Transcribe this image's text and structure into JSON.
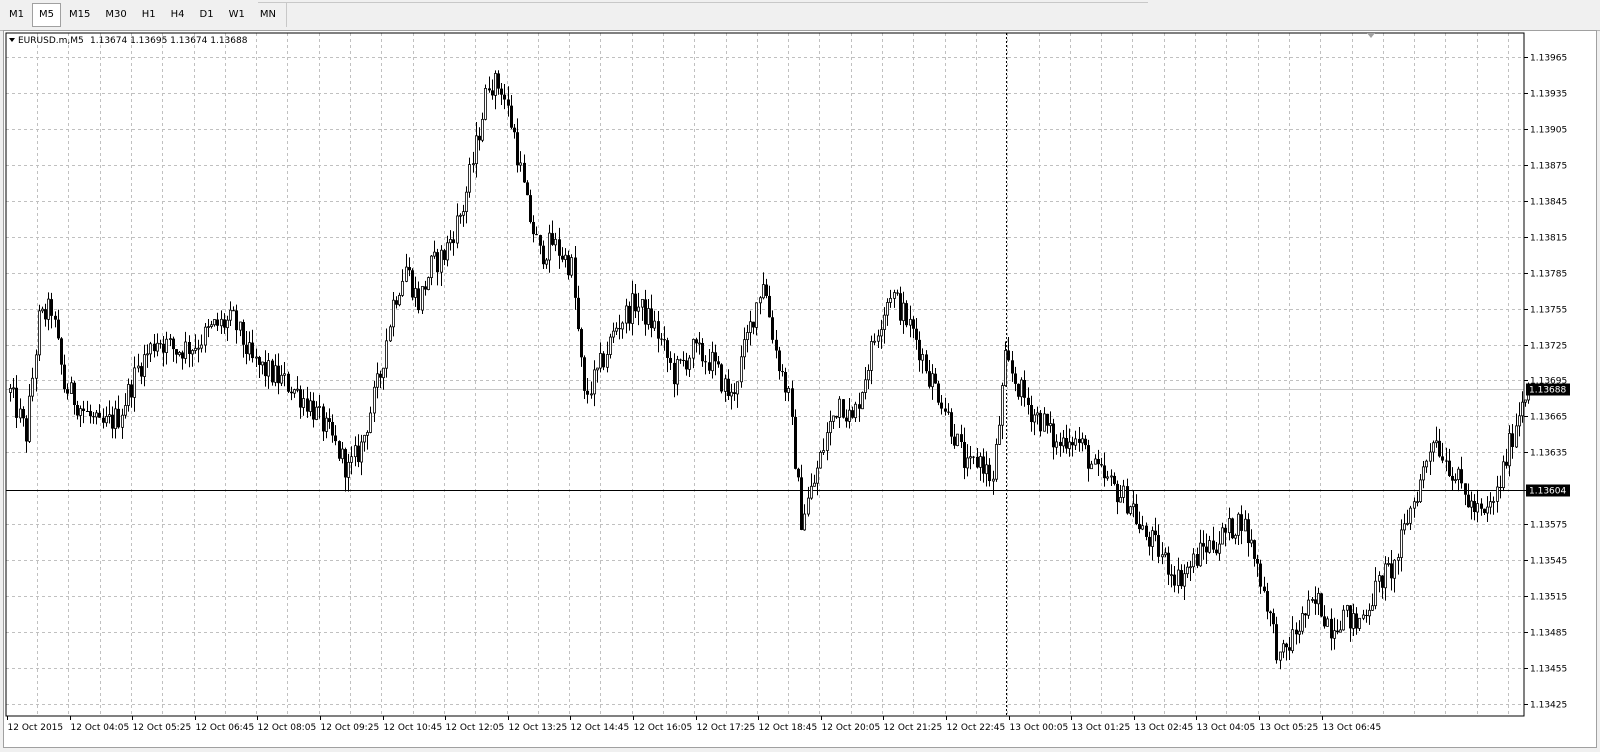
{
  "toolbar": {
    "timeframes": [
      "M1",
      "M5",
      "M15",
      "M30",
      "H1",
      "H4",
      "D1",
      "W1",
      "MN"
    ],
    "active": "M5"
  },
  "chart_header": {
    "symbol": "EURUSD.m,M5",
    "ohlc": "1.13674 1.13695 1.13674 1.13688"
  },
  "colors": {
    "background": "#ffffff",
    "grid": "#c0c0c0",
    "candle": "#000000",
    "bid_line": "#000000",
    "price_label_bg": "#000000",
    "price_label_text": "#ffffff"
  },
  "chart_data": {
    "type": "candlestick",
    "timeframe": "M5",
    "y_tick_labels": [
      "1.13965",
      "1.13935",
      "1.13905",
      "1.13875",
      "1.13845",
      "1.13815",
      "1.13785",
      "1.13755",
      "1.13725",
      "1.13695",
      "1.13665",
      "1.13635",
      "1.13604",
      "1.13575",
      "1.13545",
      "1.13515",
      "1.13485",
      "1.13455",
      "1.13425"
    ],
    "x_tick_labels": [
      "12 Oct 2015",
      "12 Oct 04:05",
      "12 Oct 05:25",
      "12 Oct 06:45",
      "12 Oct 08:05",
      "12 Oct 09:25",
      "12 Oct 10:45",
      "12 Oct 12:05",
      "12 Oct 13:25",
      "12 Oct 14:45",
      "12 Oct 16:05",
      "12 Oct 17:25",
      "12 Oct 18:45",
      "12 Oct 20:05",
      "12 Oct 21:25",
      "12 Oct 22:45",
      "13 Oct 00:05",
      "13 Oct 01:25",
      "13 Oct 02:45",
      "13 Oct 04:05",
      "13 Oct 05:25",
      "13 Oct 06:45"
    ],
    "ylim": [
      1.13415,
      1.13985
    ],
    "grid": true,
    "grid_style": "dashed",
    "current_price": 1.13688,
    "current_price_label": "1.13688",
    "horizontal_line": 1.13604,
    "horizontal_line_label": "1.13604",
    "period_separator_label": "13 Oct 00:05",
    "path": [
      [
        0,
        1.13685
      ],
      [
        5,
        1.1365
      ],
      [
        9,
        1.13745
      ],
      [
        13,
        1.13755
      ],
      [
        17,
        1.1369
      ],
      [
        23,
        1.1367
      ],
      [
        28,
        1.13655
      ],
      [
        34,
        1.13665
      ],
      [
        40,
        1.13705
      ],
      [
        46,
        1.1373
      ],
      [
        52,
        1.1372
      ],
      [
        58,
        1.13725
      ],
      [
        64,
        1.1374
      ],
      [
        70,
        1.13745
      ],
      [
        76,
        1.1371
      ],
      [
        82,
        1.137
      ],
      [
        88,
        1.1369
      ],
      [
        94,
        1.13675
      ],
      [
        100,
        1.1365
      ],
      [
        106,
        1.1362
      ],
      [
        110,
        1.1364
      ],
      [
        116,
        1.137
      ],
      [
        120,
        1.1376
      ],
      [
        124,
        1.1379
      ],
      [
        128,
        1.1376
      ],
      [
        132,
        1.1379
      ],
      [
        136,
        1.138
      ],
      [
        142,
        1.1384
      ],
      [
        146,
        1.1389
      ],
      [
        150,
        1.13945
      ],
      [
        154,
        1.1394
      ],
      [
        158,
        1.139
      ],
      [
        162,
        1.1384
      ],
      [
        166,
        1.138
      ],
      [
        170,
        1.1381
      ],
      [
        176,
        1.1379
      ],
      [
        180,
        1.1368
      ],
      [
        184,
        1.137
      ],
      [
        190,
        1.1374
      ],
      [
        196,
        1.1376
      ],
      [
        202,
        1.1374
      ],
      [
        208,
        1.137
      ],
      [
        214,
        1.1372
      ],
      [
        220,
        1.1371
      ],
      [
        226,
        1.1368
      ],
      [
        232,
        1.1374
      ],
      [
        236,
        1.1378
      ],
      [
        240,
        1.1372
      ],
      [
        244,
        1.1368
      ],
      [
        248,
        1.1358
      ],
      [
        252,
        1.1361
      ],
      [
        256,
        1.1365
      ],
      [
        260,
        1.1368
      ],
      [
        264,
        1.1366
      ],
      [
        268,
        1.137
      ],
      [
        272,
        1.1374
      ],
      [
        276,
        1.1377
      ],
      [
        280,
        1.1375
      ],
      [
        284,
        1.1373
      ],
      [
        288,
        1.137
      ],
      [
        292,
        1.1368
      ],
      [
        296,
        1.1365
      ],
      [
        300,
        1.1362
      ],
      [
        304,
        1.1363
      ],
      [
        308,
        1.1361
      ],
      [
        312,
        1.1371
      ],
      [
        316,
        1.1369
      ],
      [
        320,
        1.1367
      ],
      [
        324,
        1.1366
      ],
      [
        328,
        1.1364
      ],
      [
        332,
        1.1365
      ],
      [
        336,
        1.1364
      ],
      [
        340,
        1.1362
      ],
      [
        344,
        1.1361
      ],
      [
        348,
        1.136
      ],
      [
        352,
        1.1359
      ],
      [
        354,
        1.1357
      ],
      [
        358,
        1.1356
      ],
      [
        362,
        1.13545
      ],
      [
        366,
        1.1353
      ],
      [
        370,
        1.1354
      ],
      [
        374,
        1.13555
      ],
      [
        378,
        1.1356
      ],
      [
        382,
        1.1357
      ],
      [
        386,
        1.1358
      ],
      [
        390,
        1.1355
      ],
      [
        394,
        1.1351
      ],
      [
        398,
        1.1346
      ],
      [
        402,
        1.1348
      ],
      [
        406,
        1.135
      ],
      [
        410,
        1.1351
      ],
      [
        414,
        1.1349
      ],
      [
        418,
        1.135
      ],
      [
        422,
        1.1349
      ],
      [
        426,
        1.1351
      ],
      [
        430,
        1.1353
      ],
      [
        434,
        1.1354
      ],
      [
        438,
        1.1358
      ],
      [
        442,
        1.1361
      ],
      [
        446,
        1.1365
      ],
      [
        450,
        1.1363
      ],
      [
        454,
        1.1361
      ],
      [
        458,
        1.1359
      ],
      [
        462,
        1.1358
      ],
      [
        466,
        1.136
      ],
      [
        470,
        1.1364
      ],
      [
        474,
        1.1368
      ],
      [
        476,
        1.13688
      ]
    ]
  }
}
